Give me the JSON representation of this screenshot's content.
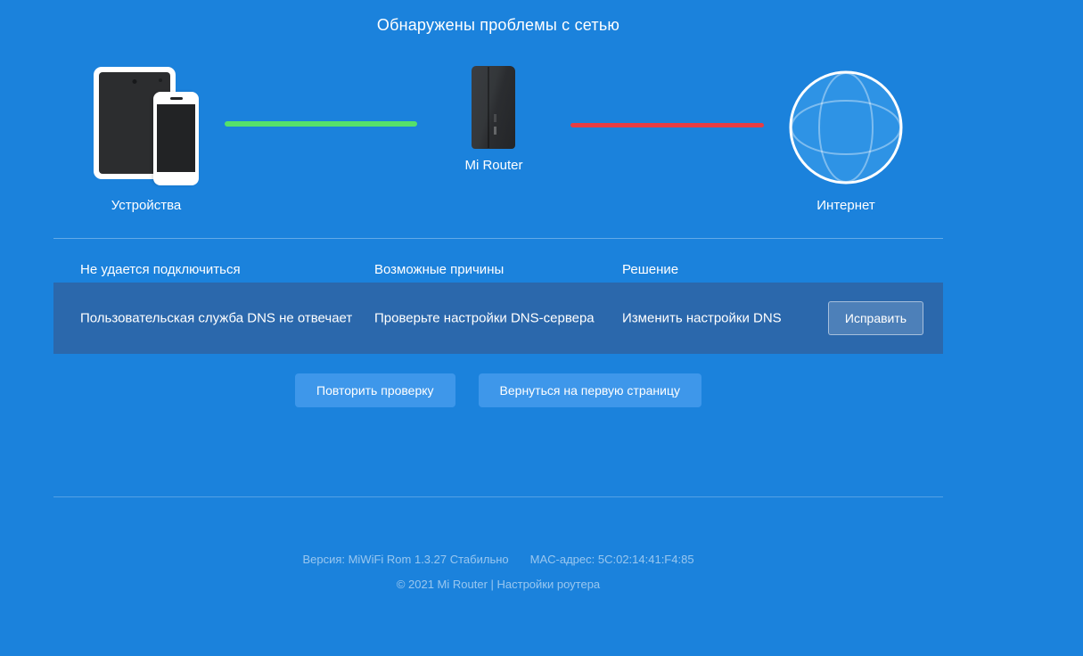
{
  "page": {
    "title": "Обнаружены проблемы с сетью"
  },
  "diagram": {
    "devices_label": "Устройства",
    "router_label": "Mi Router",
    "internet_label": "Интернет",
    "link_devices_router_status": "ok",
    "link_router_internet_status": "error"
  },
  "table": {
    "headers": [
      "Не удается подключиться",
      "Возможные причины",
      "Решение"
    ],
    "rows": [
      {
        "problem": "Пользовательская служба DNS не отвечает",
        "cause": "Проверьте настройки DNS-сервера",
        "solution": "Изменить настройки DNS",
        "action_label": "Исправить"
      }
    ]
  },
  "actions": {
    "retry_label": "Повторить проверку",
    "back_label": "Вернуться на первую страницу"
  },
  "footer": {
    "version": "Версия: MiWiFi Rom 1.3.27 Стабильно",
    "mac": "MAC-адрес: 5C:02:14:41:F4:85",
    "copyright": "© 2021 Mi Router | Настройки роутера"
  },
  "colors": {
    "page_background": "#1b82dc",
    "problem_row_background": "#2b68ac",
    "connection_ok": "#55e16b",
    "connection_error": "#e73c44",
    "action_button": "#3e97ea",
    "globe_fill": "#2e93e5"
  }
}
